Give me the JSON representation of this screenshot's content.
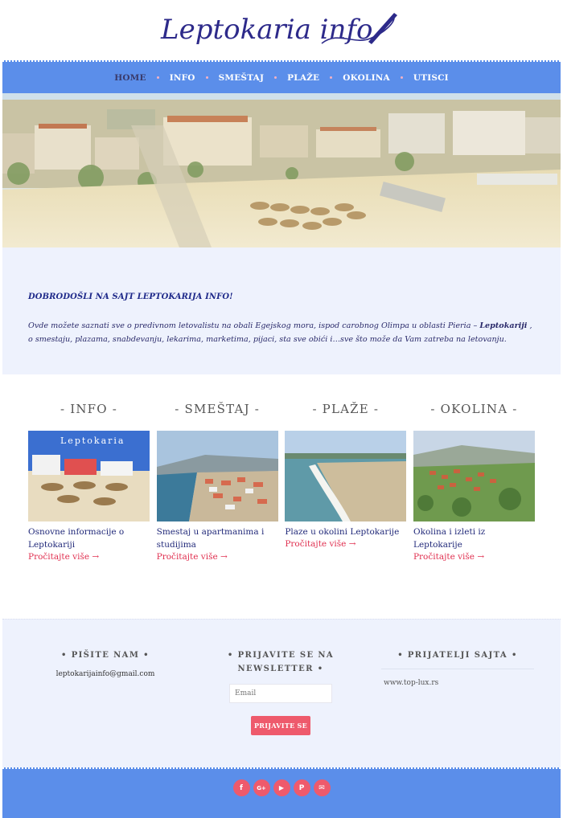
{
  "site": {
    "logo_text": "Leptokaria info"
  },
  "nav": {
    "items": [
      {
        "label": "HOME",
        "active": true
      },
      {
        "label": "INFO"
      },
      {
        "label": "SMEŠTAJ"
      },
      {
        "label": "PLAŽE"
      },
      {
        "label": "OKOLINA"
      },
      {
        "label": "UTISCI"
      }
    ]
  },
  "welcome": {
    "heading": "DOBRODOŠLI NA SAJT LEPTOKARIJA INFO!",
    "text_before": "Ovde možete saznati sve o predivnom letovalistu na obali Egejskog mora, ispod carobnog Olimpa u oblasti Pieria – ",
    "text_bold": "Leptokariji",
    "text_after": " , o smestaju, plazama, snabdevanju, lekarima, marketima, pijaci, sta sve obići i…sve što može da Vam zatreba na letovanju."
  },
  "cards": [
    {
      "title": "- INFO -",
      "image_caption": "Leptokaria",
      "desc": "Osnovne informacije o Leptokariji",
      "more": "Pročitajte više →"
    },
    {
      "title": "- SMEŠTAJ -",
      "desc": "Smestaj u apartmanima i studijima",
      "more": "Pročitajte više →"
    },
    {
      "title": "- PLAŽE -",
      "desc": "Plaze u okolini Leptokarije",
      "more": "Pročitajte više →"
    },
    {
      "title": "- OKOLINA -",
      "desc": "Okolina i izleti iz Leptokarije",
      "more": "Pročitajte više →"
    }
  ],
  "footer": {
    "contact": {
      "title": "• PIŠITE NAM •",
      "email": "leptokarijainfo@gmail.com"
    },
    "newsletter": {
      "title_line1": "• PRIJAVITE SE NA",
      "title_line2": "NEWSLETTER •",
      "placeholder": "Email",
      "button": "PRIJAVITE SE"
    },
    "friends": {
      "title": "• PRIJATELJI SAJTA •",
      "link": "www.top-lux.rs"
    }
  },
  "socials": [
    {
      "icon": "facebook-icon",
      "glyph": "f"
    },
    {
      "icon": "google-plus-icon",
      "glyph": "G+"
    },
    {
      "icon": "youtube-icon",
      "glyph": "▶"
    },
    {
      "icon": "pinterest-icon",
      "glyph": "P"
    },
    {
      "icon": "mail-icon",
      "glyph": "✉"
    }
  ],
  "colors": {
    "nav_bg": "#5b8eea",
    "accent": "#ee5a6c",
    "panel_bg": "#eef2fd",
    "link_red": "#e03050"
  }
}
